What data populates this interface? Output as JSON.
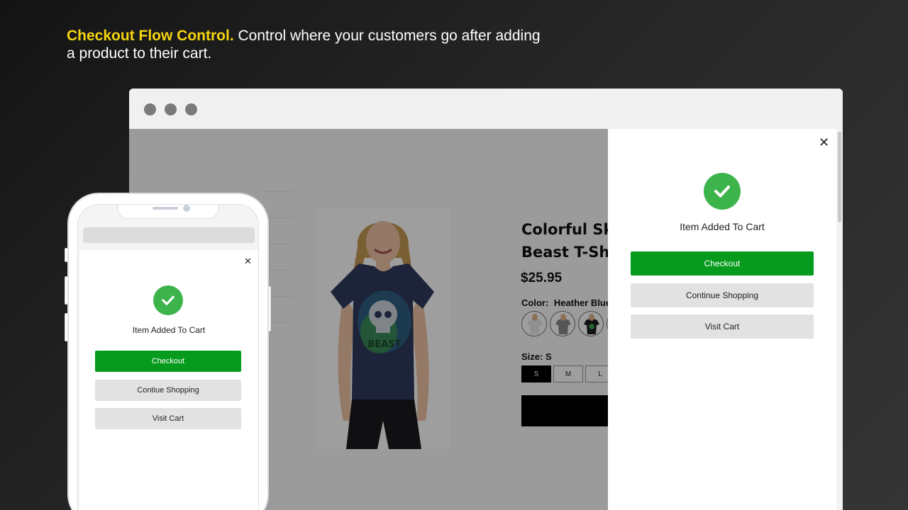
{
  "headline": {
    "bold": "Checkout Flow Control.",
    "text": "Control where your customers go after adding a product to their cart."
  },
  "colors": {
    "accent": "#f5d40f",
    "checkout_green": "#079b1d",
    "check_green": "#3cb44b",
    "secondary_button": "#e2e2e2"
  },
  "product": {
    "title": "Colorful Skull Beast T-Shirt",
    "price": "$25.95",
    "color_label": "Color:",
    "color_value": "Heather Blue",
    "size_label": "Size:",
    "size_value": "S",
    "sizes": [
      "S",
      "M",
      "L"
    ],
    "shirt_print": "BEAST"
  },
  "desktop_drawer": {
    "close_icon": "close-icon",
    "success_icon": "check-circle-icon",
    "title": "Item Added To Cart",
    "checkout_label": "Checkout",
    "continue_label": "Continue Shopping",
    "cart_label": "Visit Cart"
  },
  "mobile_drawer": {
    "close_icon": "close-icon",
    "success_icon": "check-circle-icon",
    "title": "Item Added To Cart",
    "checkout_label": "Checkout",
    "continue_label": "Contiue Shopping",
    "cart_label": "Visit Cart"
  }
}
